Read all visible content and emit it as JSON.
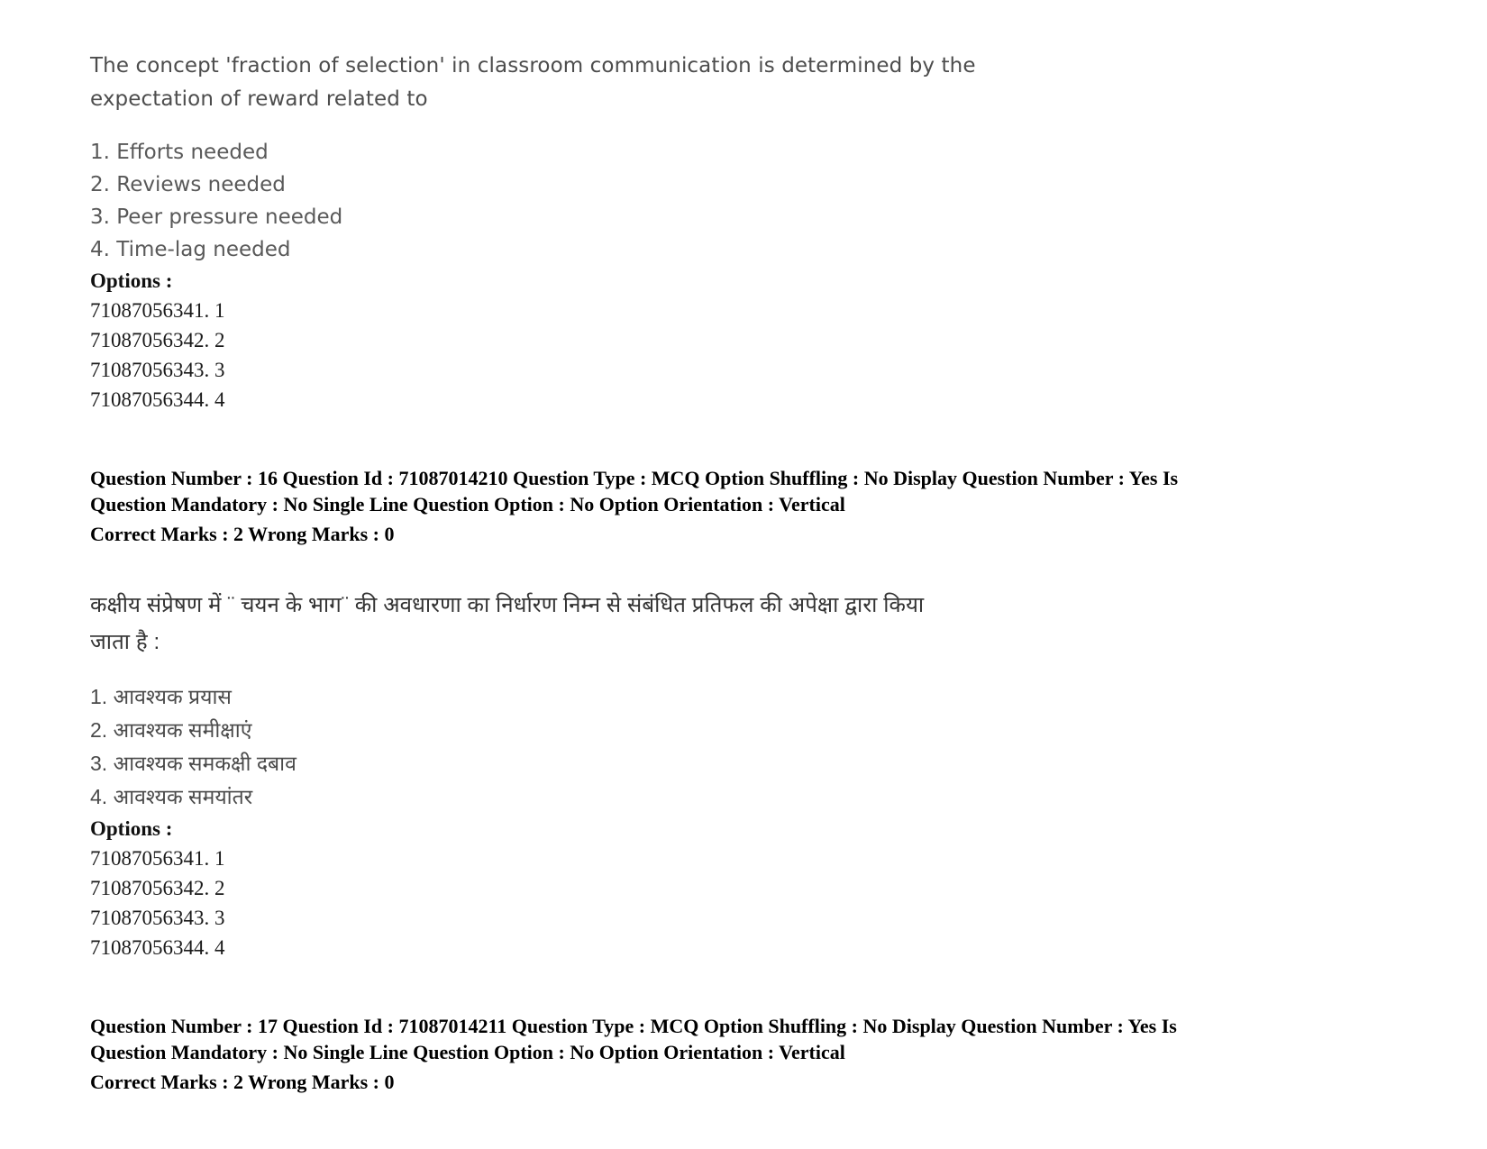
{
  "document": {
    "background_color": "#ffffff",
    "text_color": "#333333"
  },
  "questions": [
    {
      "language": "en",
      "stem_line1": "The concept 'fraction of selection' in classroom communication is determined by the",
      "stem_line2": "expectation of reward related to",
      "choices": [
        "1. Efforts needed",
        "2. Reviews needed",
        "3. Peer pressure needed",
        "4. Time-lag needed"
      ],
      "options_label": "Options :",
      "option_ids": [
        "71087056341. 1",
        "71087056342. 2",
        "71087056343. 3",
        "71087056344. 4"
      ]
    },
    {
      "language": "hi",
      "stem_line1": "कक्षीय संप्रेषण में ¨ चयन के भाग¨ की अवधारणा का निर्धारण निम्न से संबंधित प्रतिफल की अपेक्षा द्वारा किया",
      "stem_line2": "जाता है :",
      "choices": [
        "1. आवश्यक प्रयास",
        "2. आवश्यक समीक्षाएं",
        "3. आवश्यक समकक्षी दबाव",
        "4. आवश्यक समयांतर"
      ],
      "options_label": "Options :",
      "option_ids": [
        "71087056341. 1",
        "71087056342. 2",
        "71087056343. 3",
        "71087056344. 4"
      ]
    }
  ],
  "metadata_blocks": [
    {
      "line1": "Question Number : 16 Question Id : 71087014210 Question Type : MCQ Option Shuffling : No Display Question Number : Yes Is",
      "line2": "Question Mandatory : No Single Line Question Option : No Option Orientation : Vertical",
      "line3": "Correct Marks : 2 Wrong Marks : 0"
    },
    {
      "line1": "Question Number : 17 Question Id : 71087014211 Question Type : MCQ Option Shuffling : No Display Question Number : Yes Is",
      "line2": "Question Mandatory : No Single Line Question Option : No Option Orientation : Vertical",
      "line3": "Correct Marks : 2 Wrong Marks : 0"
    }
  ]
}
